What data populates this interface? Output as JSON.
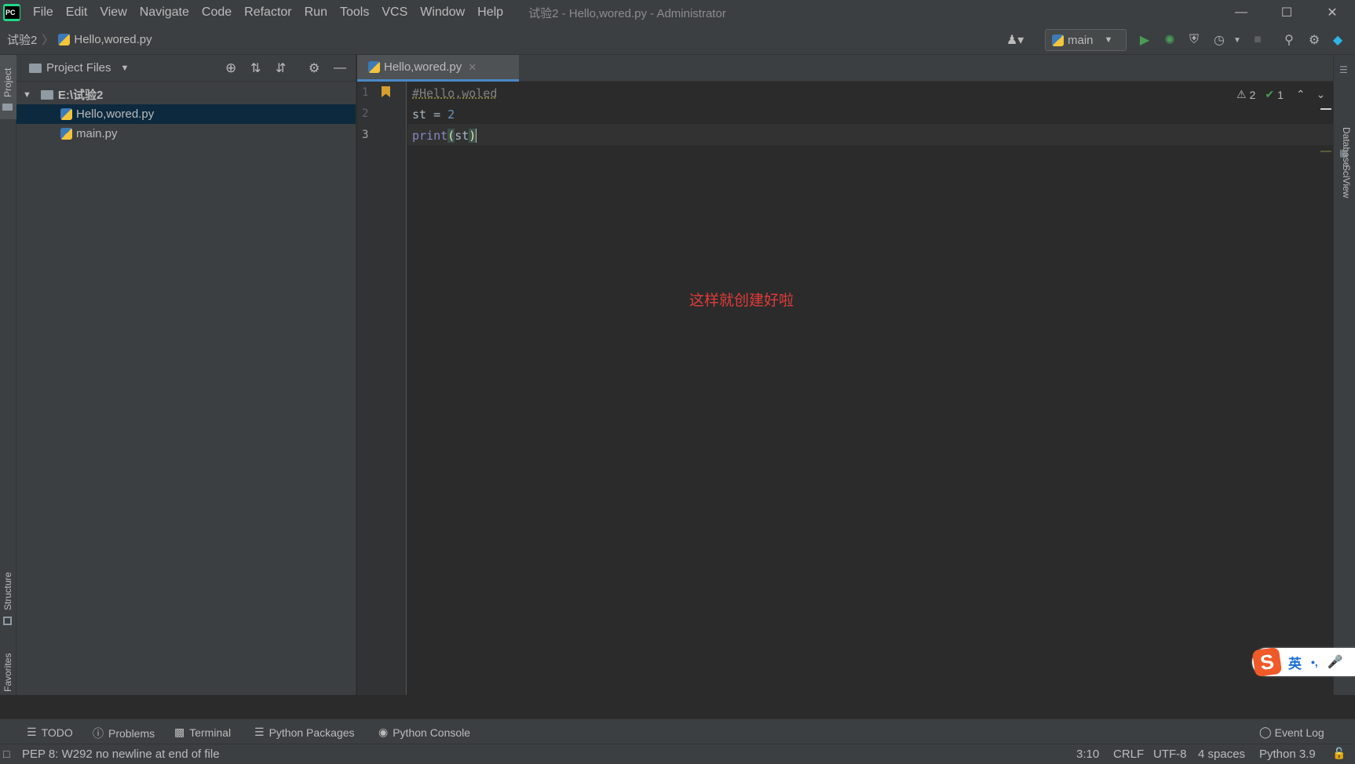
{
  "titlebar": {
    "menu": [
      "File",
      "Edit",
      "View",
      "Navigate",
      "Code",
      "Refactor",
      "Run",
      "Tools",
      "VCS",
      "Window",
      "Help"
    ],
    "window_title": "试验2 - Hello,wored.py - Administrator"
  },
  "navbar": {
    "project": "试验2",
    "file": "Hello,wored.py",
    "run_config": "main"
  },
  "project_panel": {
    "header": "Project Files",
    "root": "E:\\试验2",
    "files": [
      "Hello,wored.py",
      "main.py"
    ]
  },
  "editor": {
    "tab": "Hello,wored.py",
    "lines": [
      {
        "num": "1",
        "text": "#Hello,woled"
      },
      {
        "num": "2",
        "text": "st = 2"
      },
      {
        "num": "3",
        "text": "print(st)"
      }
    ],
    "warnings": "2",
    "checks": "1",
    "annotation": "这样就创建好啦"
  },
  "sidebars": {
    "left_top": "Project",
    "left_structure": "Structure",
    "left_favorites": "Favorites",
    "right_database": "Database",
    "right_sciview": "SciView"
  },
  "bottom_tools": [
    "TODO",
    "Problems",
    "Terminal",
    "Python Packages",
    "Python Console"
  ],
  "event_log": "Event Log",
  "status": {
    "message": "PEP 8: W292 no newline at end of file",
    "position": "3:10",
    "line_sep": "CRLF",
    "encoding": "UTF-8",
    "indent": "4 spaces",
    "interpreter": "Python 3.9"
  },
  "ime": {
    "mode": "英",
    "punct": "•,"
  },
  "colors": {
    "accent": "#4a88c7",
    "annotation": "#e03b3b",
    "run": "#499c54"
  }
}
